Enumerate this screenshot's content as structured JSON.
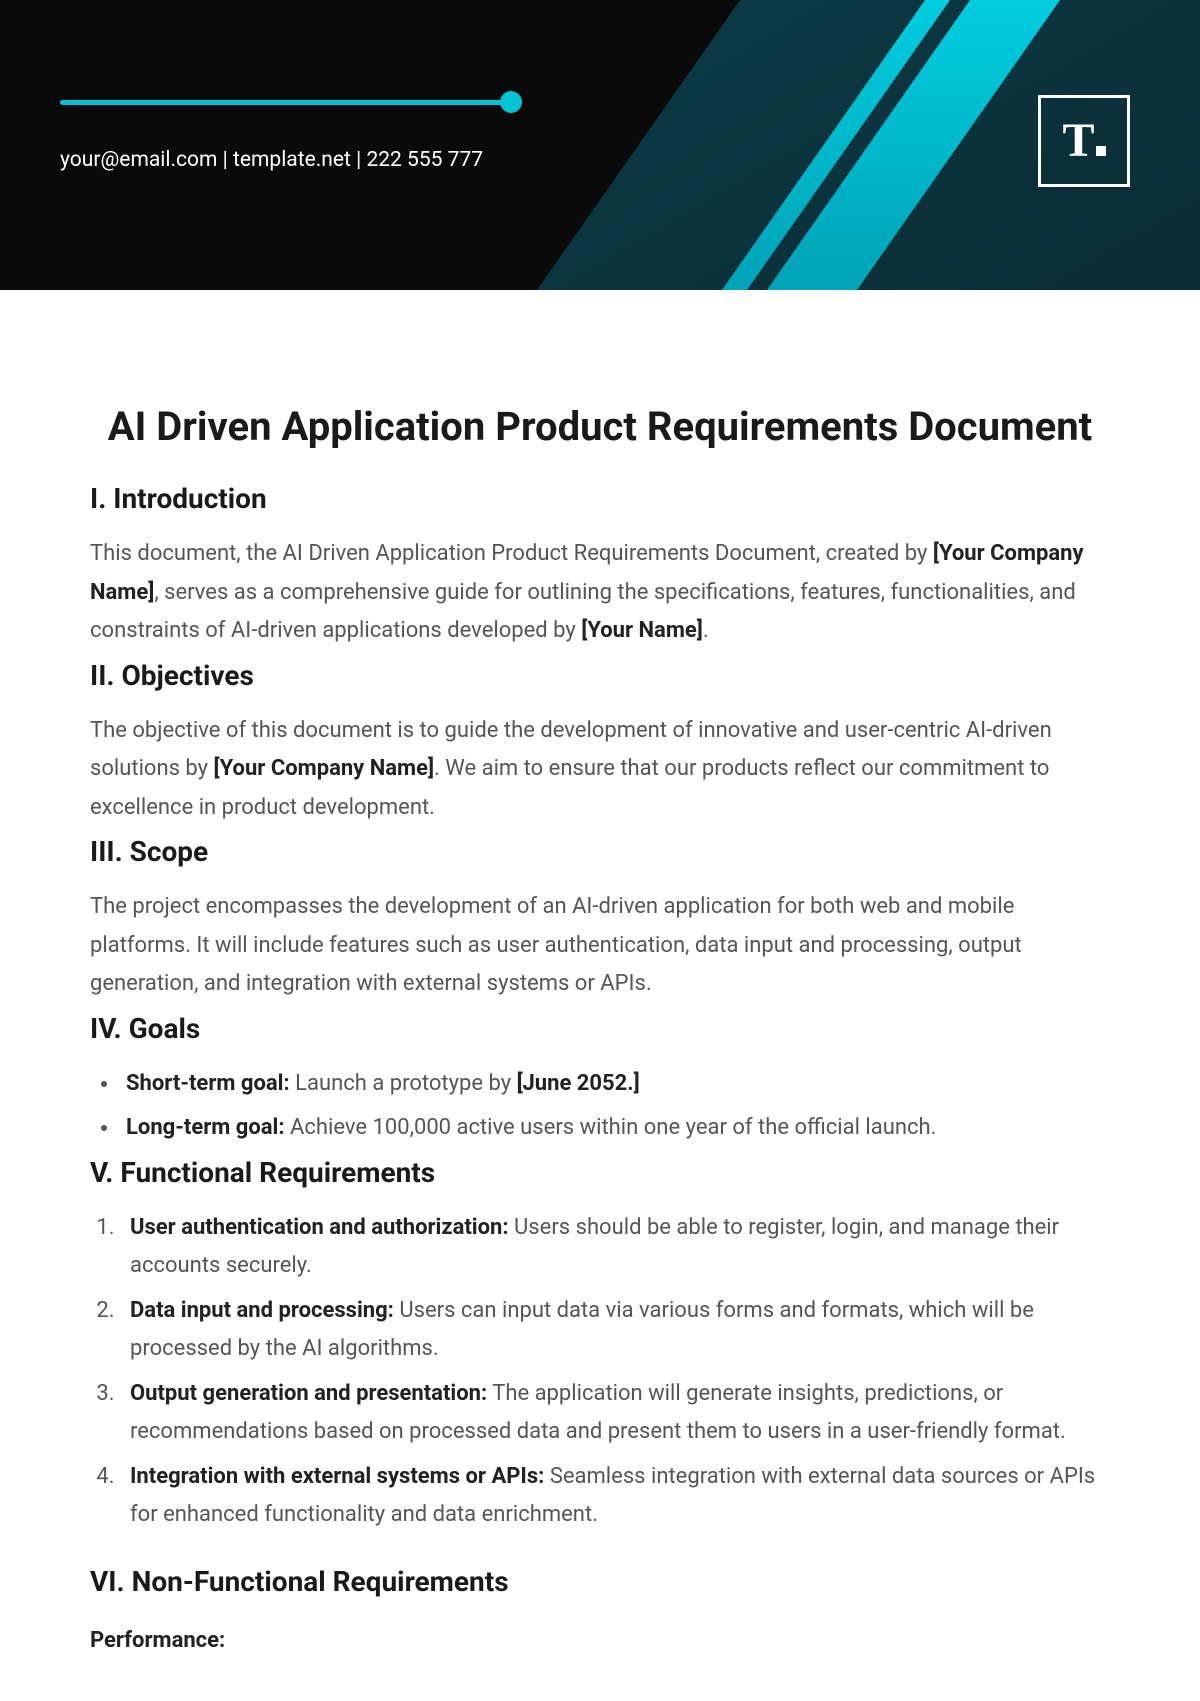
{
  "header": {
    "contact_email": "your@email.com",
    "contact_site": "template.net",
    "contact_phone": "222 555 777",
    "logo_letter": "T"
  },
  "title": "AI Driven Application Product Requirements Document",
  "sections": {
    "intro": {
      "heading": "I. Introduction",
      "text_pre": "This document, the AI Driven Application Product Requirements Document, created by ",
      "placeholder1": "[Your Company Name]",
      "text_mid": ", serves as a comprehensive guide for outlining the specifications, features, functionalities, and constraints of AI-driven applications developed by ",
      "placeholder2": "[Your Name]",
      "text_end": "."
    },
    "objectives": {
      "heading": "II. Objectives",
      "text_pre": "The objective of this document is to guide the development of innovative and user-centric AI-driven solutions by ",
      "placeholder": "[Your Company Name]",
      "text_end": ". We aim to ensure that our products reflect our commitment to excellence in product development."
    },
    "scope": {
      "heading": "III. Scope",
      "text": "The project encompasses the development of an AI-driven application for both web and mobile platforms. It will include features such as user authentication, data input and processing, output generation, and integration with external systems or APIs."
    },
    "goals": {
      "heading": "IV. Goals",
      "items": [
        {
          "label": "Short-term goal:",
          "text_pre": " Launch a prototype by ",
          "placeholder": "[June 2052.]",
          "text_end": ""
        },
        {
          "label": "Long-term goal:",
          "text_pre": " Achieve 100,000 active users within one year of the official launch.",
          "placeholder": "",
          "text_end": ""
        }
      ]
    },
    "functional": {
      "heading": "V. Functional Requirements",
      "items": [
        {
          "label": "User authentication and authorization:",
          "text": " Users should be able to register, login, and manage their accounts securely."
        },
        {
          "label": "Data input and processing:",
          "text": " Users can input data via various forms and formats, which will be processed by the AI algorithms."
        },
        {
          "label": "Output generation and presentation:",
          "text": " The application will generate insights, predictions, or recommendations based on processed data and present them to users in a user-friendly format."
        },
        {
          "label": "Integration with external systems or APIs:",
          "text": " Seamless integration with external data sources or APIs for enhanced functionality and data enrichment."
        }
      ]
    },
    "nonfunctional": {
      "heading": "VI. Non-Functional Requirements",
      "subheading": "Performance:"
    }
  }
}
